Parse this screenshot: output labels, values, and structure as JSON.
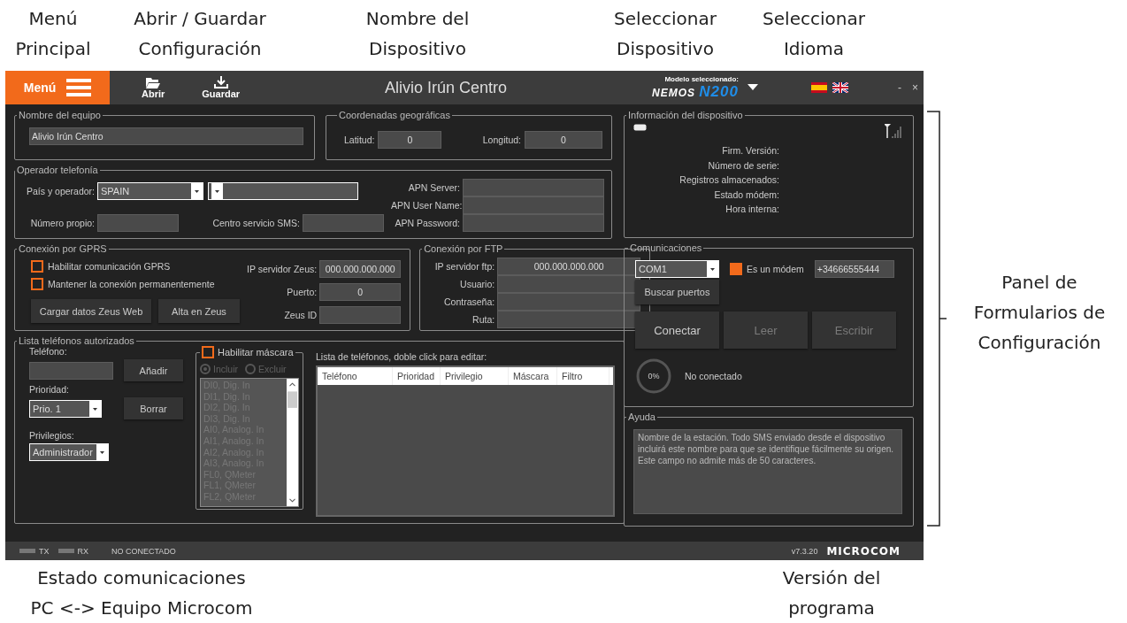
{
  "annotations": [
    {
      "text": "Menú\nPrincipal"
    },
    {
      "text": "Abrir / Guardar\nConfiguración"
    },
    {
      "text": "Nombre del\nDispositivo"
    },
    {
      "text": "Seleccionar\nDispositivo"
    },
    {
      "text": "Seleccionar\nIdioma"
    },
    {
      "text": "Panel de\nFormularios de\nConfiguración"
    },
    {
      "text": "Estado comunicaciones\nPC <-> Equipo Microcom"
    },
    {
      "text": "Versión del\nprograma"
    }
  ],
  "titlebar": {
    "menu_button": "Menú",
    "open_button": "Abrir",
    "save_button": "Guardar",
    "title": "Alivio Irún Centro",
    "device_selector": {
      "caption": "Modelo seleccionado:",
      "logo_left": "NEMOS",
      "logo_right": "N200"
    },
    "window_controls": [
      "-",
      "×"
    ]
  },
  "equipo": {
    "legend": "Nombre del equipo",
    "name": "Alivio Irún Centro"
  },
  "coords": {
    "legend": "Coordenadas geográficas",
    "fields": [
      {
        "label": "Latitud:",
        "value": "0"
      },
      {
        "label": "Longitud:",
        "value": "0"
      }
    ]
  },
  "operador": {
    "legend": "Operador telefonía",
    "country_label": "País y operador:",
    "country": "SPAIN",
    "own_number_label": "Número propio:",
    "sms_center_label": "Centro servicio SMS:",
    "apn_fields": [
      {
        "label": "APN Server:"
      },
      {
        "label": "APN User Name:"
      },
      {
        "label": "APN Password:"
      }
    ]
  },
  "gprs": {
    "legend": "Conexión por GPRS",
    "checkboxes": [
      {
        "label": "Habilitar comunicación GPRS",
        "checked": false
      },
      {
        "label": "Mantener la conexión permanentemente",
        "checked": false
      }
    ],
    "buttons": [
      "Cargar datos Zeus Web",
      "Alta en Zeus"
    ],
    "fields": [
      {
        "label": "IP servidor Zeus:",
        "value": "000.000.000.000"
      },
      {
        "label": "Puerto:",
        "value": "0"
      },
      {
        "label": "Zeus ID"
      }
    ]
  },
  "ftp": {
    "legend": "Conexión por FTP",
    "fields": [
      {
        "label": "IP servidor ftp:",
        "value": "000.000.000.000"
      },
      {
        "label": "Usuario:"
      },
      {
        "label": "Contraseña:"
      },
      {
        "label": "Ruta:"
      }
    ]
  },
  "phones": {
    "legend": "Lista teléfonos autorizados",
    "phone_label": "Teléfono:",
    "add_button": "Añadir",
    "priority_label": "Prioridad:",
    "priority": "Prio. 1",
    "delete_button": "Borrar",
    "privileges_label": "Privilegios:",
    "privilege": "Administrador",
    "mask": {
      "label": "Habilitar máscara",
      "checked": false,
      "disabled": true,
      "modes": [
        {
          "label": "Incluir",
          "selected": true
        },
        {
          "label": "Excluir",
          "selected": false
        }
      ],
      "channels": [
        "DI0, Dig. In",
        "DI1, Dig. In",
        "DI2, Dig. In",
        "DI3, Dig. In",
        "AI0, Analog. In",
        "AI1, Analog. In",
        "AI2, Analog. In",
        "AI3, Analog. In",
        "FL0, QMeter",
        "FL1, QMeter",
        "FL2, QMeter"
      ]
    },
    "table": {
      "caption": "Lista de teléfonos, doble click para editar:",
      "columns": [
        "Teléfono",
        "Prioridad",
        "Privilegio",
        "Máscara",
        "Filtro"
      ]
    }
  },
  "device_info": {
    "legend": "Información del dispositivo",
    "fields": [
      {
        "label": "Firm. Versión:"
      },
      {
        "label": "Número de serie:"
      },
      {
        "label": "Registros almacenados:"
      },
      {
        "label": "Estado módem:"
      },
      {
        "label": "Hora interna:"
      }
    ]
  },
  "comms": {
    "legend": "Comunicaciones",
    "port": "COM1",
    "search_button": "Buscar puertos",
    "modem": {
      "label": "Es un módem",
      "checked": true
    },
    "modem_number": "+34666555444",
    "actions": [
      {
        "label": "Conectar",
        "disabled": false
      },
      {
        "label": "Leer",
        "disabled": true
      },
      {
        "label": "Escribir",
        "disabled": true
      }
    ],
    "progress": {
      "label": "0%",
      "level": 0
    },
    "status": "No conectado"
  },
  "help": {
    "legend": "Ayuda",
    "text": "Nombre de la estación. Todo SMS enviado desde el dispositivo incluirá este nombre para que se identifique fácilmente su origen. Este campo no admite más de 50 caracteres."
  },
  "status_bar": {
    "indicators": [
      {
        "label": "TX",
        "on": false
      },
      {
        "label": "RX",
        "on": false
      }
    ],
    "connection": "NO CONECTADO",
    "version": "v7.3.20",
    "logo": "MICROCOM"
  }
}
